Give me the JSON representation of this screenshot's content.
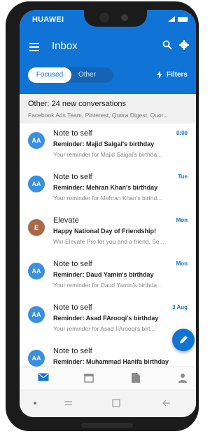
{
  "device": {
    "brand": "HUAWEI"
  },
  "app": {
    "title": "Inbox"
  },
  "tabs": [
    {
      "label": "Focused"
    },
    {
      "label": "Other"
    }
  ],
  "filters": {
    "label": "Filters"
  },
  "other_banner": {
    "title": "Other: 24 new conversations",
    "subtitle": "Facebook Ads Team, Pinterest, Quora Digest, Quor..."
  },
  "messages": [
    {
      "avatar": "AA",
      "avatar_color": "#3a8fe0",
      "sender": "Note to self",
      "date": "0:00",
      "subject": "Reminder: Majid Saigal's birthday",
      "preview": "Your reminder for Majid Saigal's birthda..."
    },
    {
      "avatar": "AA",
      "avatar_color": "#3a8fe0",
      "sender": "Note to self",
      "date": "Tue",
      "subject": "Reminder: Mehran Khan's birthday",
      "preview": "Your reminder for Mehran Khan's birthd..."
    },
    {
      "avatar": "E",
      "avatar_color": "#a86a4a",
      "sender": "Elevate",
      "date": "Mon",
      "subject": "Happy National Day of Friendship!",
      "preview": "Win Elevate Pro for you and a friend. Se..."
    },
    {
      "avatar": "AA",
      "avatar_color": "#3a8fe0",
      "sender": "Note to self",
      "date": "Mon",
      "subject": "Reminder: Daud Yamin's birthday",
      "preview": "Your reminder for Daud Yamin's birthda..."
    },
    {
      "avatar": "AA",
      "avatar_color": "#3a8fe0",
      "sender": "Note to self",
      "date": "3 Aug",
      "subject": "Reminder: Asad FArooqi's birthday",
      "preview": "Your reminder for Asad FArooqi's birt..."
    },
    {
      "avatar": "AA",
      "avatar_color": "#3a8fe0",
      "sender": "Note to self",
      "date": "",
      "subject": "Reminder: Muhammad Hanifa birthday",
      "preview": ""
    }
  ],
  "colors": {
    "accent": "#0f74d6",
    "unread_date": "#0f74d6"
  },
  "icons": {
    "menu": "menu-icon",
    "search": "search-icon",
    "settings": "gear-icon",
    "filters": "lightning-icon",
    "compose": "pencil-icon",
    "nav": [
      "mail-icon",
      "calendar-icon",
      "file-icon",
      "people-icon"
    ],
    "system": [
      "dot-icon",
      "switch-icon",
      "square-icon",
      "back-icon"
    ]
  }
}
